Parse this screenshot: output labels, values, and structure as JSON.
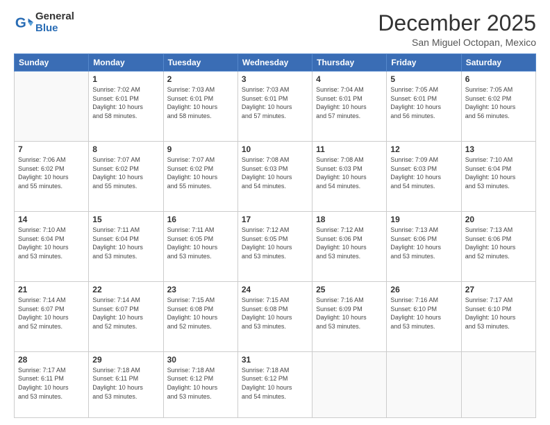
{
  "header": {
    "logo_general": "General",
    "logo_blue": "Blue",
    "month": "December 2025",
    "location": "San Miguel Octopan, Mexico"
  },
  "days_of_week": [
    "Sunday",
    "Monday",
    "Tuesday",
    "Wednesday",
    "Thursday",
    "Friday",
    "Saturday"
  ],
  "weeks": [
    [
      {
        "day": "",
        "info": ""
      },
      {
        "day": "1",
        "info": "Sunrise: 7:02 AM\nSunset: 6:01 PM\nDaylight: 10 hours\nand 58 minutes."
      },
      {
        "day": "2",
        "info": "Sunrise: 7:03 AM\nSunset: 6:01 PM\nDaylight: 10 hours\nand 58 minutes."
      },
      {
        "day": "3",
        "info": "Sunrise: 7:03 AM\nSunset: 6:01 PM\nDaylight: 10 hours\nand 57 minutes."
      },
      {
        "day": "4",
        "info": "Sunrise: 7:04 AM\nSunset: 6:01 PM\nDaylight: 10 hours\nand 57 minutes."
      },
      {
        "day": "5",
        "info": "Sunrise: 7:05 AM\nSunset: 6:01 PM\nDaylight: 10 hours\nand 56 minutes."
      },
      {
        "day": "6",
        "info": "Sunrise: 7:05 AM\nSunset: 6:02 PM\nDaylight: 10 hours\nand 56 minutes."
      }
    ],
    [
      {
        "day": "7",
        "info": "Sunrise: 7:06 AM\nSunset: 6:02 PM\nDaylight: 10 hours\nand 55 minutes."
      },
      {
        "day": "8",
        "info": "Sunrise: 7:07 AM\nSunset: 6:02 PM\nDaylight: 10 hours\nand 55 minutes."
      },
      {
        "day": "9",
        "info": "Sunrise: 7:07 AM\nSunset: 6:02 PM\nDaylight: 10 hours\nand 55 minutes."
      },
      {
        "day": "10",
        "info": "Sunrise: 7:08 AM\nSunset: 6:03 PM\nDaylight: 10 hours\nand 54 minutes."
      },
      {
        "day": "11",
        "info": "Sunrise: 7:08 AM\nSunset: 6:03 PM\nDaylight: 10 hours\nand 54 minutes."
      },
      {
        "day": "12",
        "info": "Sunrise: 7:09 AM\nSunset: 6:03 PM\nDaylight: 10 hours\nand 54 minutes."
      },
      {
        "day": "13",
        "info": "Sunrise: 7:10 AM\nSunset: 6:04 PM\nDaylight: 10 hours\nand 53 minutes."
      }
    ],
    [
      {
        "day": "14",
        "info": "Sunrise: 7:10 AM\nSunset: 6:04 PM\nDaylight: 10 hours\nand 53 minutes."
      },
      {
        "day": "15",
        "info": "Sunrise: 7:11 AM\nSunset: 6:04 PM\nDaylight: 10 hours\nand 53 minutes."
      },
      {
        "day": "16",
        "info": "Sunrise: 7:11 AM\nSunset: 6:05 PM\nDaylight: 10 hours\nand 53 minutes."
      },
      {
        "day": "17",
        "info": "Sunrise: 7:12 AM\nSunset: 6:05 PM\nDaylight: 10 hours\nand 53 minutes."
      },
      {
        "day": "18",
        "info": "Sunrise: 7:12 AM\nSunset: 6:06 PM\nDaylight: 10 hours\nand 53 minutes."
      },
      {
        "day": "19",
        "info": "Sunrise: 7:13 AM\nSunset: 6:06 PM\nDaylight: 10 hours\nand 53 minutes."
      },
      {
        "day": "20",
        "info": "Sunrise: 7:13 AM\nSunset: 6:06 PM\nDaylight: 10 hours\nand 52 minutes."
      }
    ],
    [
      {
        "day": "21",
        "info": "Sunrise: 7:14 AM\nSunset: 6:07 PM\nDaylight: 10 hours\nand 52 minutes."
      },
      {
        "day": "22",
        "info": "Sunrise: 7:14 AM\nSunset: 6:07 PM\nDaylight: 10 hours\nand 52 minutes."
      },
      {
        "day": "23",
        "info": "Sunrise: 7:15 AM\nSunset: 6:08 PM\nDaylight: 10 hours\nand 52 minutes."
      },
      {
        "day": "24",
        "info": "Sunrise: 7:15 AM\nSunset: 6:08 PM\nDaylight: 10 hours\nand 53 minutes."
      },
      {
        "day": "25",
        "info": "Sunrise: 7:16 AM\nSunset: 6:09 PM\nDaylight: 10 hours\nand 53 minutes."
      },
      {
        "day": "26",
        "info": "Sunrise: 7:16 AM\nSunset: 6:10 PM\nDaylight: 10 hours\nand 53 minutes."
      },
      {
        "day": "27",
        "info": "Sunrise: 7:17 AM\nSunset: 6:10 PM\nDaylight: 10 hours\nand 53 minutes."
      }
    ],
    [
      {
        "day": "28",
        "info": "Sunrise: 7:17 AM\nSunset: 6:11 PM\nDaylight: 10 hours\nand 53 minutes."
      },
      {
        "day": "29",
        "info": "Sunrise: 7:18 AM\nSunset: 6:11 PM\nDaylight: 10 hours\nand 53 minutes."
      },
      {
        "day": "30",
        "info": "Sunrise: 7:18 AM\nSunset: 6:12 PM\nDaylight: 10 hours\nand 53 minutes."
      },
      {
        "day": "31",
        "info": "Sunrise: 7:18 AM\nSunset: 6:12 PM\nDaylight: 10 hours\nand 54 minutes."
      },
      {
        "day": "",
        "info": ""
      },
      {
        "day": "",
        "info": ""
      },
      {
        "day": "",
        "info": ""
      }
    ]
  ]
}
